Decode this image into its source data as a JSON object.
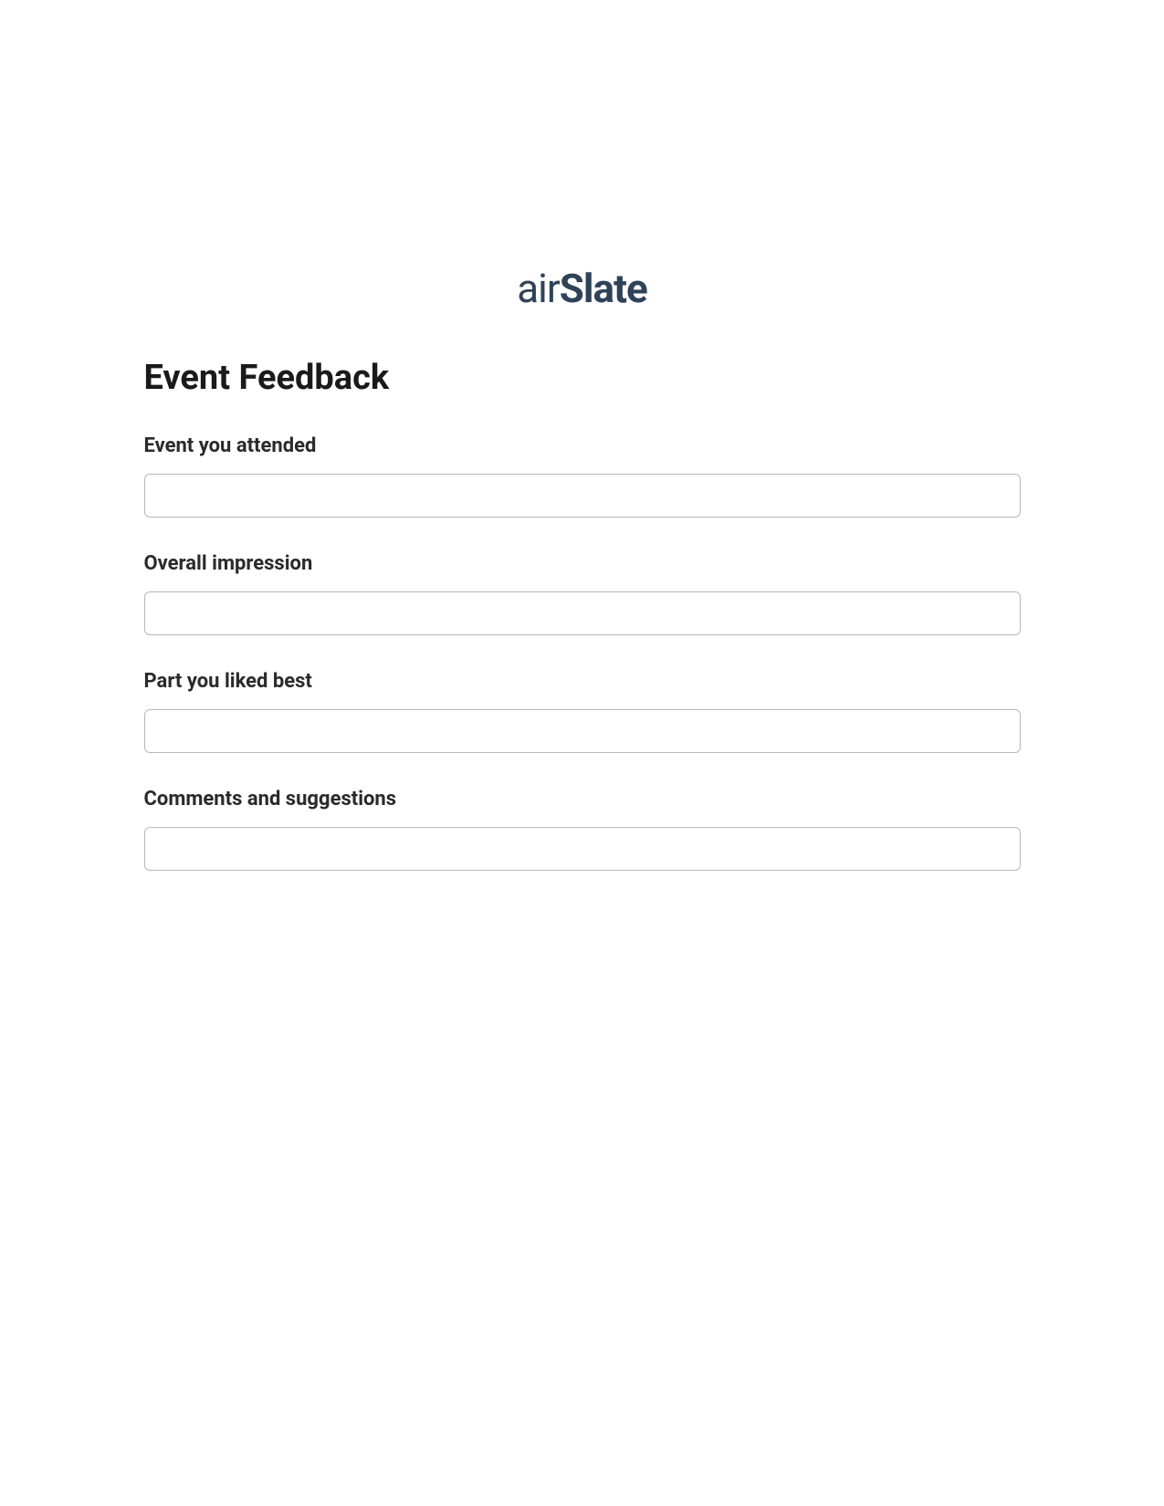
{
  "logo": {
    "prefix": "air",
    "suffix": "Slate"
  },
  "form": {
    "title": "Event Feedback",
    "fields": [
      {
        "label": "Event you attended",
        "value": ""
      },
      {
        "label": "Overall impression",
        "value": ""
      },
      {
        "label": "Part you liked best",
        "value": ""
      },
      {
        "label": "Comments and suggestions",
        "value": ""
      }
    ]
  }
}
